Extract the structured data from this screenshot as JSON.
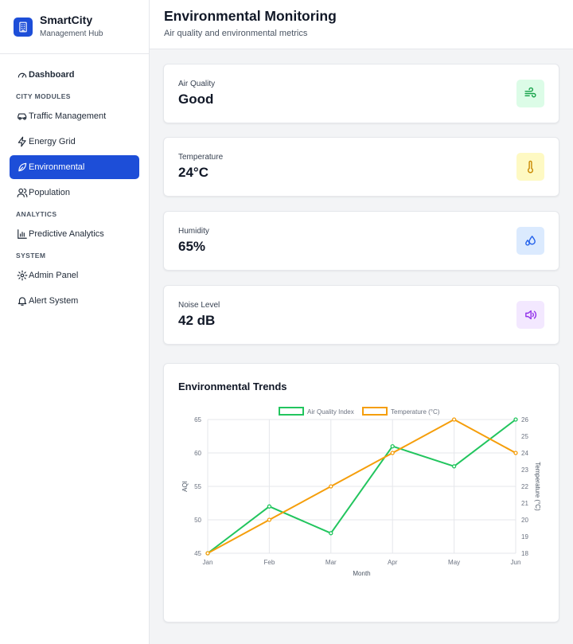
{
  "brand": {
    "name": "SmartCity",
    "subtitle": "Management Hub",
    "icon": "building-icon"
  },
  "sidebar": {
    "dashboard": {
      "label": "Dashboard",
      "icon": "gauge-icon"
    },
    "sections": [
      {
        "title": "CITY MODULES"
      },
      {
        "title": "ANALYTICS"
      },
      {
        "title": "SYSTEM"
      }
    ],
    "items": [
      {
        "label": "Traffic Management",
        "icon": "car-icon"
      },
      {
        "label": "Energy Grid",
        "icon": "lightning-icon"
      },
      {
        "label": "Environmental",
        "icon": "leaf-icon",
        "active": true
      },
      {
        "label": "Population",
        "icon": "users-icon"
      },
      {
        "label": "Predictive Analytics",
        "icon": "bar-chart-icon"
      },
      {
        "label": "Admin Panel",
        "icon": "gear-icon"
      },
      {
        "label": "Alert System",
        "icon": "bell-icon"
      }
    ]
  },
  "header": {
    "title": "Environmental Monitoring",
    "subtitle": "Air quality and environmental metrics"
  },
  "metrics": [
    {
      "label": "Air Quality",
      "value": "Good",
      "icon": "wind-icon",
      "color": "#16a34a",
      "bg": "#dcfce7"
    },
    {
      "label": "Temperature",
      "value": "24°C",
      "icon": "thermometer-icon",
      "color": "#ca8a04",
      "bg": "#fef9c3"
    },
    {
      "label": "Humidity",
      "value": "65%",
      "icon": "droplets-icon",
      "color": "#2563eb",
      "bg": "#dbeafe"
    },
    {
      "label": "Noise Level",
      "value": "42 dB",
      "icon": "speaker-icon",
      "color": "#9333ea",
      "bg": "#f3e8ff"
    }
  ],
  "chart_title": "Environmental Trends",
  "chart_data": {
    "type": "line",
    "categories": [
      "Jan",
      "Feb",
      "Mar",
      "Apr",
      "May",
      "Jun"
    ],
    "series": [
      {
        "name": "Air Quality Index",
        "values": [
          45,
          52,
          48,
          61,
          58,
          65
        ],
        "color": "#22c55e",
        "axis": "left"
      },
      {
        "name": "Temperature (°C)",
        "values": [
          18,
          20,
          22,
          24,
          26,
          24
        ],
        "color": "#f59e0b",
        "axis": "right"
      }
    ],
    "xlabel": "Month",
    "ylabel": "AQI",
    "y2label": "Temperature (°C)",
    "ylim": [
      45,
      65
    ],
    "y2lim": [
      18,
      26
    ],
    "yticks": [
      45,
      50,
      55,
      60,
      65
    ],
    "y2ticks": [
      18,
      19,
      20,
      21,
      22,
      23,
      24,
      25,
      26
    ],
    "grid": true,
    "legend": "top"
  }
}
